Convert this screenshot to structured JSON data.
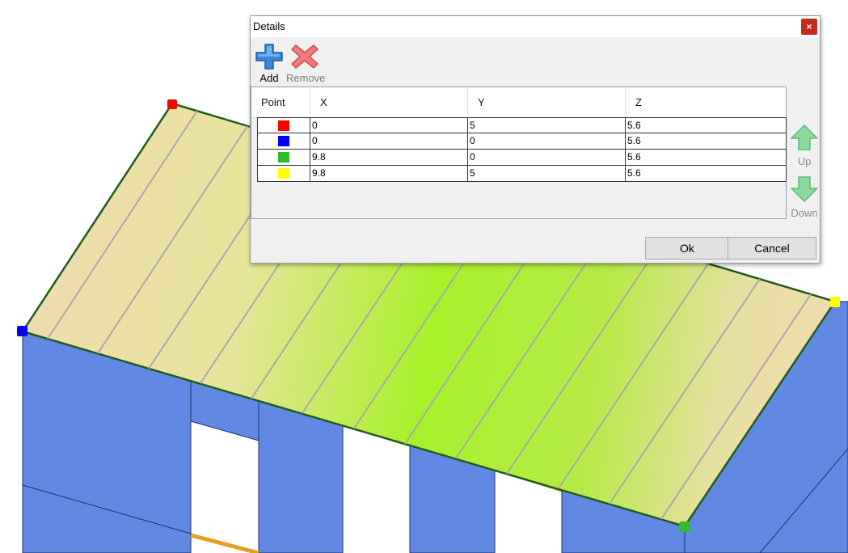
{
  "dialog": {
    "title": "Details",
    "close_glyph": "×",
    "toolbar": {
      "add_label": "Add",
      "remove_label": "Remove"
    },
    "table": {
      "columns": [
        "Point",
        "X",
        "Y",
        "Z"
      ],
      "rows": [
        {
          "point_color": "#ff0000",
          "x": "0",
          "y": "5",
          "z": "5.6"
        },
        {
          "point_color": "#0000ff",
          "x": "0",
          "y": "0",
          "z": "5.6"
        },
        {
          "point_color": "#2ebd2e",
          "x": "9.8",
          "y": "0",
          "z": "5.6"
        },
        {
          "point_color": "#ffff00",
          "x": "9.8",
          "y": "5",
          "z": "5.6"
        }
      ]
    },
    "side_buttons": {
      "up_label": "Up",
      "down_label": "Down"
    },
    "buttons": {
      "ok_label": "Ok",
      "cancel_label": "Cancel"
    }
  },
  "icons": {
    "add": "plus-icon",
    "remove": "x-icon",
    "up": "arrow-up-icon",
    "down": "arrow-down-icon"
  },
  "colors": {
    "wall": "#6189e3",
    "roof_green": "#a8f02a",
    "roof_tan": "#efdcae",
    "beam_orange": "#e0a020",
    "close_red": "#c42b1c"
  }
}
